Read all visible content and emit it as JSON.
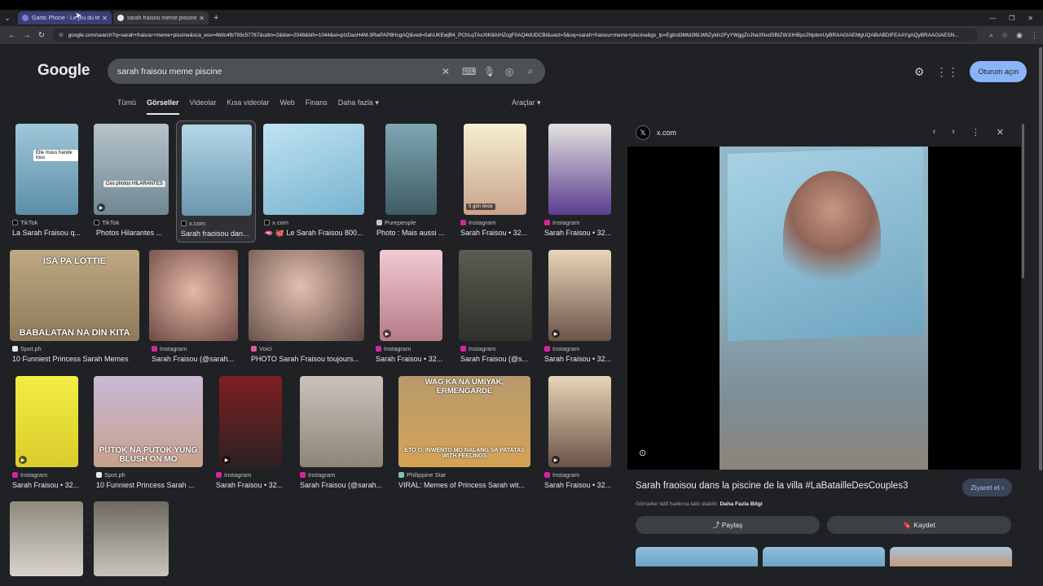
{
  "browser": {
    "tabs": [
      {
        "title": "Gartic Phone - Le jeu du téléph",
        "active": false
      },
      {
        "title": "sarah fraisou meme piscine - G",
        "active": true
      }
    ],
    "url": "google.com/search?q=sarah+fraisou+meme+piscine&sca_esv=4b9c4fb793c57767&udm=2&biw=2048&bih=1044&ei=pIzDacH4M-3RwPAP8HcgAQ&ved=0ahUKEwjB4_PChLqTAxXtK8AIHZcgF0AQ4dUDCBI&uact=5&oq=sarah+fraisou+meme+piscine&gs_lp=Egtnd3Mtd2l6LWltZyIdc2FyYWggZnJhaXNvdSBtZW1lIHBpc2NpbmUyBRAAGIAEMgUQABiABDIFEAAYgAQyBRAAGIAESN..."
  },
  "google": {
    "logo": "Google",
    "query": "sarah fraisou meme piscine",
    "signin": "Oturum açın",
    "tabs": [
      "Tümü",
      "Görseller",
      "Videolar",
      "Kısa videolar",
      "Web",
      "Finans",
      "Daha fazla"
    ],
    "tools": "Araçlar"
  },
  "results": [
    {
      "source": "TikTok",
      "title": "La Sarah Fraisou q...",
      "overlay": "Elle mous hande tous"
    },
    {
      "source": "TikTok",
      "title": "Photos Hilarantes ...",
      "overlay": "Ces photos HILARANTES"
    },
    {
      "source": "x.com",
      "title": "Sarah fraoisou dan..."
    },
    {
      "source": "x.com",
      "title": "🫦 🐙 Le Sarah Fraisou 800..."
    },
    {
      "source": "Purepeople",
      "title": "Photo : Mais aussi ..."
    },
    {
      "source": "Instagram",
      "title": "Sarah Fraisou • 32...",
      "overlay": "5 gün önce"
    },
    {
      "source": "Instagram",
      "title": "Sarah Fraisou • 32..."
    },
    {
      "source": "Spot.ph",
      "title": "10 Funniest Princess Sarah Memes",
      "overlay_top": "ISA PA LOTTIE",
      "overlay_bottom": "BABALATAN NA DIN KITA"
    },
    {
      "source": "Instagram",
      "title": "Sarah Fraisou (@sarah..."
    },
    {
      "source": "Voici",
      "title": "PHOTO Sarah Fraisou toujours..."
    },
    {
      "source": "Instagram",
      "title": "Sarah Fraisou • 32..."
    },
    {
      "source": "Instagram",
      "title": "Sarah Fraisou (@s..."
    },
    {
      "source": "Instagram",
      "title": "Sarah Fraisou • 32..."
    },
    {
      "source": "Instagram",
      "title": "Sarah Fraisou • 32..."
    },
    {
      "source": "Spot.ph",
      "title": "10 Funniest Princess Sarah ...",
      "overlay_bottom": "PUTOK NA PUTOK YUNG BLUSH ON MO"
    },
    {
      "source": "Instagram",
      "title": "Sarah Fraisou • 32..."
    },
    {
      "source": "Instagram",
      "title": "Sarah Fraisou (@sarah..."
    },
    {
      "source": "Philippine Star",
      "title": "VIRAL: Memes of Princess Sarah wit...",
      "overlay_top": "WAG KA NA UMIYAK, ERMENGARDE",
      "overlay_bottom": "ETO O, INWENTO MO NALANG SA PATATAS WITH FEELINGS"
    },
    {
      "source": "Instagram",
      "title": "Sarah Fraisou • 32..."
    }
  ],
  "preview": {
    "site": "x.com",
    "title": "Sarah fraoisou dans la piscine de la villa #LaBatailleDesCouples3",
    "visit": "Ziyaret et",
    "copyright_text": "Görseller telif hakkına tabi olabilir.",
    "copyright_link": "Daha Fazla Bilgi",
    "share": "Paylaş",
    "save": "Kaydet"
  },
  "colors": {
    "accent": "#8ab4f8",
    "tab_active": "#3b3f74",
    "bg": "#202124"
  }
}
